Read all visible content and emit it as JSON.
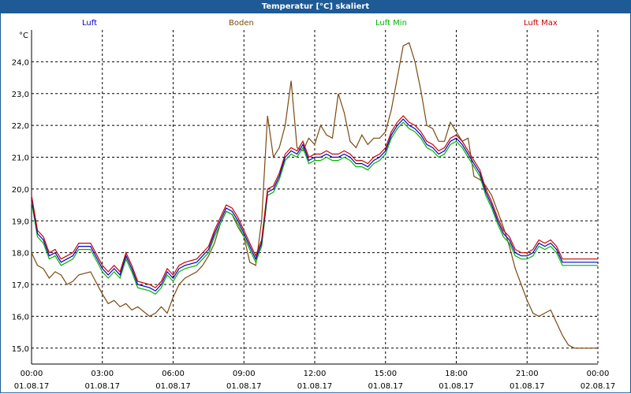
{
  "window": {
    "title": "Temperatur [°C] skaliert"
  },
  "colors": {
    "title_bar": "#1e5a96",
    "luft": "#0000cc",
    "boden": "#7a4a10",
    "luft_min": "#00b400",
    "luft_max": "#cc0000"
  },
  "chart_data": {
    "type": "line",
    "title": "Temperatur [°C] skaliert",
    "ylabel": "°C",
    "ylim": [
      14.5,
      25.0
    ],
    "xlim_hours": [
      0,
      24
    ],
    "yticks": [
      "15,0",
      "16,0",
      "17,0",
      "18,0",
      "19,0",
      "20,0",
      "21,0",
      "22,0",
      "23,0",
      "24,0"
    ],
    "xticks": [
      {
        "time": "00:00",
        "date": "01.08.17"
      },
      {
        "time": "03:00",
        "date": "01.08.17"
      },
      {
        "time": "06:00",
        "date": "01.08.17"
      },
      {
        "time": "09:00",
        "date": "01.08.17"
      },
      {
        "time": "12:00",
        "date": "01.08.17"
      },
      {
        "time": "15:00",
        "date": "01.08.17"
      },
      {
        "time": "18:00",
        "date": "01.08.17"
      },
      {
        "time": "21:00",
        "date": "01.08.17"
      },
      {
        "time": "00:00",
        "date": "02.08.17"
      }
    ],
    "grid": true,
    "legend_position": "top",
    "series": [
      {
        "name": "Luft",
        "color": "#0000cc",
        "x": [
          0,
          0.25,
          0.5,
          0.75,
          1,
          1.25,
          1.5,
          1.75,
          2,
          2.5,
          3,
          3.25,
          3.5,
          3.75,
          4,
          4.25,
          4.5,
          5,
          5.25,
          5.5,
          5.75,
          6,
          6.25,
          6.5,
          7,
          7.25,
          7.5,
          7.75,
          8,
          8.25,
          8.5,
          8.75,
          9,
          9.25,
          9.5,
          9.75,
          10,
          10.25,
          10.5,
          10.75,
          11,
          11.25,
          11.5,
          11.75,
          12,
          12.25,
          12.5,
          12.75,
          13,
          13.25,
          13.5,
          13.75,
          14,
          14.25,
          14.5,
          14.75,
          15,
          15.25,
          15.5,
          15.75,
          16,
          16.25,
          16.5,
          16.75,
          17,
          17.25,
          17.5,
          17.75,
          18,
          18.25,
          18.5,
          18.75,
          19,
          19.25,
          19.5,
          19.75,
          20,
          20.25,
          20.5,
          20.75,
          21,
          21.25,
          21.5,
          21.75,
          22,
          22.25,
          22.5,
          22.75,
          23,
          23.25,
          23.5,
          23.75,
          24
        ],
        "values": [
          19.7,
          18.6,
          18.4,
          17.9,
          18.0,
          17.7,
          17.8,
          17.9,
          18.2,
          18.2,
          17.5,
          17.3,
          17.5,
          17.3,
          17.9,
          17.5,
          17.0,
          16.9,
          16.8,
          17.0,
          17.4,
          17.2,
          17.5,
          17.6,
          17.7,
          17.9,
          18.1,
          18.6,
          19.0,
          19.4,
          19.3,
          19.0,
          18.6,
          18.2,
          17.8,
          18.3,
          19.9,
          20.0,
          20.4,
          21.0,
          21.2,
          21.1,
          21.4,
          20.9,
          21.0,
          21.0,
          21.1,
          21.0,
          21.0,
          21.1,
          21.0,
          20.8,
          20.8,
          20.7,
          20.9,
          21.0,
          21.2,
          21.7,
          22.0,
          22.2,
          22.0,
          21.9,
          21.7,
          21.4,
          21.3,
          21.1,
          21.2,
          21.5,
          21.6,
          21.4,
          21.1,
          20.8,
          20.5,
          19.9,
          19.5,
          19.0,
          18.6,
          18.4,
          18.0,
          17.9,
          17.9,
          18.0,
          18.3,
          18.2,
          18.3,
          18.1,
          17.7,
          17.7,
          17.7,
          17.7,
          17.7,
          17.7,
          17.7
        ]
      },
      {
        "name": "Boden",
        "color": "#7a4a10",
        "x": [
          0,
          0.25,
          0.5,
          0.75,
          1,
          1.25,
          1.5,
          1.75,
          2,
          2.5,
          3,
          3.25,
          3.5,
          3.75,
          4,
          4.25,
          4.5,
          5,
          5.25,
          5.5,
          5.75,
          6,
          6.25,
          6.5,
          7,
          7.25,
          7.5,
          7.75,
          8,
          8.25,
          8.5,
          8.75,
          9,
          9.25,
          9.5,
          9.75,
          10,
          10.25,
          10.5,
          10.75,
          11,
          11.25,
          11.5,
          11.75,
          12,
          12.25,
          12.5,
          12.75,
          13,
          13.25,
          13.5,
          13.75,
          14,
          14.25,
          14.5,
          14.75,
          15,
          15.25,
          15.5,
          15.75,
          16,
          16.25,
          16.5,
          16.75,
          17,
          17.25,
          17.5,
          17.75,
          18,
          18.25,
          18.5,
          18.75,
          19,
          19.25,
          19.5,
          19.75,
          20,
          20.25,
          20.5,
          20.75,
          21,
          21.25,
          21.5,
          21.75,
          22,
          22.25,
          22.5,
          22.75,
          23,
          23.25,
          23.5,
          23.75,
          24
        ],
        "values": [
          18.0,
          17.6,
          17.5,
          17.2,
          17.4,
          17.3,
          17.0,
          17.1,
          17.3,
          17.4,
          16.7,
          16.4,
          16.5,
          16.3,
          16.4,
          16.2,
          16.3,
          16.0,
          16.1,
          16.3,
          16.1,
          16.6,
          17.0,
          17.2,
          17.4,
          17.6,
          17.9,
          18.3,
          18.9,
          19.3,
          19.2,
          18.8,
          18.5,
          17.7,
          17.6,
          19.0,
          22.3,
          21.0,
          21.3,
          22.0,
          23.4,
          21.3,
          21.2,
          21.6,
          21.4,
          22.0,
          21.7,
          21.6,
          23.0,
          22.4,
          21.5,
          21.3,
          21.7,
          21.4,
          21.6,
          21.6,
          21.8,
          22.5,
          23.5,
          24.5,
          24.6,
          24.0,
          23.1,
          22.0,
          21.9,
          21.5,
          21.5,
          22.1,
          21.8,
          21.5,
          21.6,
          20.4,
          20.3,
          20.1,
          19.8,
          19.3,
          18.8,
          18.2,
          17.5,
          17.0,
          16.5,
          16.1,
          16.0,
          16.1,
          16.2,
          15.8,
          15.4,
          15.1,
          15.0,
          15.0,
          15.0,
          15.0,
          15.0
        ]
      },
      {
        "name": "Luft Min",
        "color": "#00b400",
        "x": [
          0,
          0.25,
          0.5,
          0.75,
          1,
          1.25,
          1.5,
          1.75,
          2,
          2.5,
          3,
          3.25,
          3.5,
          3.75,
          4,
          4.25,
          4.5,
          5,
          5.25,
          5.5,
          5.75,
          6,
          6.25,
          6.5,
          7,
          7.25,
          7.5,
          7.75,
          8,
          8.25,
          8.5,
          8.75,
          9,
          9.25,
          9.5,
          9.75,
          10,
          10.25,
          10.5,
          10.75,
          11,
          11.25,
          11.5,
          11.75,
          12,
          12.25,
          12.5,
          12.75,
          13,
          13.25,
          13.5,
          13.75,
          14,
          14.25,
          14.5,
          14.75,
          15,
          15.25,
          15.5,
          15.75,
          16,
          16.25,
          16.5,
          16.75,
          17,
          17.25,
          17.5,
          17.75,
          18,
          18.25,
          18.5,
          18.75,
          19,
          19.25,
          19.5,
          19.75,
          20,
          20.25,
          20.5,
          20.75,
          21,
          21.25,
          21.5,
          21.75,
          22,
          22.25,
          22.5,
          22.75,
          23,
          23.25,
          23.5,
          23.75,
          24
        ],
        "values": [
          19.6,
          18.5,
          18.3,
          17.8,
          17.9,
          17.6,
          17.7,
          17.8,
          18.1,
          18.1,
          17.4,
          17.2,
          17.4,
          17.2,
          17.8,
          17.4,
          16.9,
          16.8,
          16.7,
          16.9,
          17.3,
          17.1,
          17.4,
          17.5,
          17.6,
          17.8,
          18.0,
          18.5,
          18.9,
          19.3,
          19.2,
          18.9,
          18.5,
          18.1,
          17.7,
          18.2,
          19.8,
          19.9,
          20.3,
          20.9,
          21.1,
          21.0,
          21.3,
          20.8,
          20.9,
          20.9,
          21.0,
          20.9,
          20.9,
          21.0,
          20.9,
          20.7,
          20.7,
          20.6,
          20.8,
          20.9,
          21.1,
          21.6,
          21.9,
          22.1,
          21.9,
          21.8,
          21.6,
          21.3,
          21.2,
          21.0,
          21.1,
          21.4,
          21.5,
          21.3,
          21.0,
          20.7,
          20.4,
          19.8,
          19.4,
          18.9,
          18.5,
          18.3,
          17.9,
          17.8,
          17.8,
          17.9,
          18.2,
          18.1,
          18.2,
          18.0,
          17.6,
          17.6,
          17.6,
          17.6,
          17.6,
          17.6,
          17.6
        ]
      },
      {
        "name": "Luft Max",
        "color": "#cc0000",
        "x": [
          0,
          0.25,
          0.5,
          0.75,
          1,
          1.25,
          1.5,
          1.75,
          2,
          2.5,
          3,
          3.25,
          3.5,
          3.75,
          4,
          4.25,
          4.5,
          5,
          5.25,
          5.5,
          5.75,
          6,
          6.25,
          6.5,
          7,
          7.25,
          7.5,
          7.75,
          8,
          8.25,
          8.5,
          8.75,
          9,
          9.25,
          9.5,
          9.75,
          10,
          10.25,
          10.5,
          10.75,
          11,
          11.25,
          11.5,
          11.75,
          12,
          12.25,
          12.5,
          12.75,
          13,
          13.25,
          13.5,
          13.75,
          14,
          14.25,
          14.5,
          14.75,
          15,
          15.25,
          15.5,
          15.75,
          16,
          16.25,
          16.5,
          16.75,
          17,
          17.25,
          17.5,
          17.75,
          18,
          18.25,
          18.5,
          18.75,
          19,
          19.25,
          19.5,
          19.75,
          20,
          20.25,
          20.5,
          20.75,
          21,
          21.25,
          21.5,
          21.75,
          22,
          22.25,
          22.5,
          22.75,
          23,
          23.25,
          23.5,
          23.75,
          24
        ],
        "values": [
          19.8,
          18.7,
          18.5,
          18.0,
          18.1,
          17.8,
          17.9,
          18.0,
          18.3,
          18.3,
          17.6,
          17.4,
          17.6,
          17.4,
          18.0,
          17.6,
          17.1,
          17.0,
          16.9,
          17.1,
          17.5,
          17.3,
          17.6,
          17.7,
          17.8,
          18.0,
          18.2,
          18.7,
          19.1,
          19.5,
          19.4,
          19.1,
          18.7,
          18.3,
          17.9,
          18.4,
          20.0,
          20.1,
          20.5,
          21.1,
          21.3,
          21.2,
          21.5,
          21.0,
          21.1,
          21.1,
          21.2,
          21.1,
          21.1,
          21.2,
          21.1,
          20.9,
          20.9,
          20.8,
          21.0,
          21.1,
          21.3,
          21.8,
          22.1,
          22.3,
          22.1,
          22.0,
          21.8,
          21.5,
          21.4,
          21.2,
          21.3,
          21.6,
          21.7,
          21.5,
          21.2,
          20.9,
          20.6,
          20.0,
          19.6,
          19.1,
          18.7,
          18.5,
          18.1,
          18.0,
          18.0,
          18.1,
          18.4,
          18.3,
          18.4,
          18.2,
          17.8,
          17.8,
          17.8,
          17.8,
          17.8,
          17.8,
          17.8
        ]
      }
    ]
  }
}
